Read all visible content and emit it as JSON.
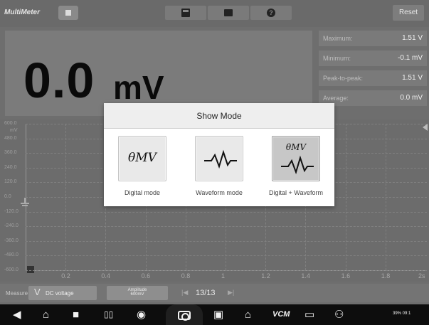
{
  "app": {
    "title": "MultiMeter"
  },
  "toolbar": {
    "reset_label": "Reset"
  },
  "reading": {
    "value": "0.0",
    "unit": "mV"
  },
  "stats": [
    {
      "label": "Maximum:",
      "value": "1.51 V"
    },
    {
      "label": "Minimum:",
      "value": "-0.1 mV"
    },
    {
      "label": "Peak-to-peak:",
      "value": "1.51 V"
    },
    {
      "label": "Average:",
      "value": "0.0 mV"
    }
  ],
  "chart": {
    "y_ticks": [
      "600.0",
      "480.0",
      "360.0",
      "240.0",
      "120.0",
      "0.0",
      "-120.0",
      "-240.0",
      "-360.0",
      "-480.0",
      "-600.0"
    ],
    "y_unit": "mV",
    "x_ticks": [
      "0.2",
      "0.4",
      "0.6",
      "0.8",
      "1",
      "1.2",
      "1.4",
      "1.6",
      "1.8",
      "2s"
    ]
  },
  "controls": {
    "measure_label": "Measure",
    "measure_value": "DC voltage",
    "amplitude_label": "Amplitude",
    "amplitude_value": "600mV",
    "page": "13/13"
  },
  "dialog": {
    "title": "Show Mode",
    "modes": [
      {
        "label": "Digital mode",
        "glyph": "θMV",
        "icon": "digital-mode-icon",
        "selected": false
      },
      {
        "label": "Waveform mode",
        "icon": "waveform-icon",
        "selected": false
      },
      {
        "label": "Digital + Waveform",
        "glyph": "θMV",
        "icon": "digital-waveform-icon",
        "selected": true
      }
    ]
  },
  "status": {
    "text": "39% 09:1"
  }
}
